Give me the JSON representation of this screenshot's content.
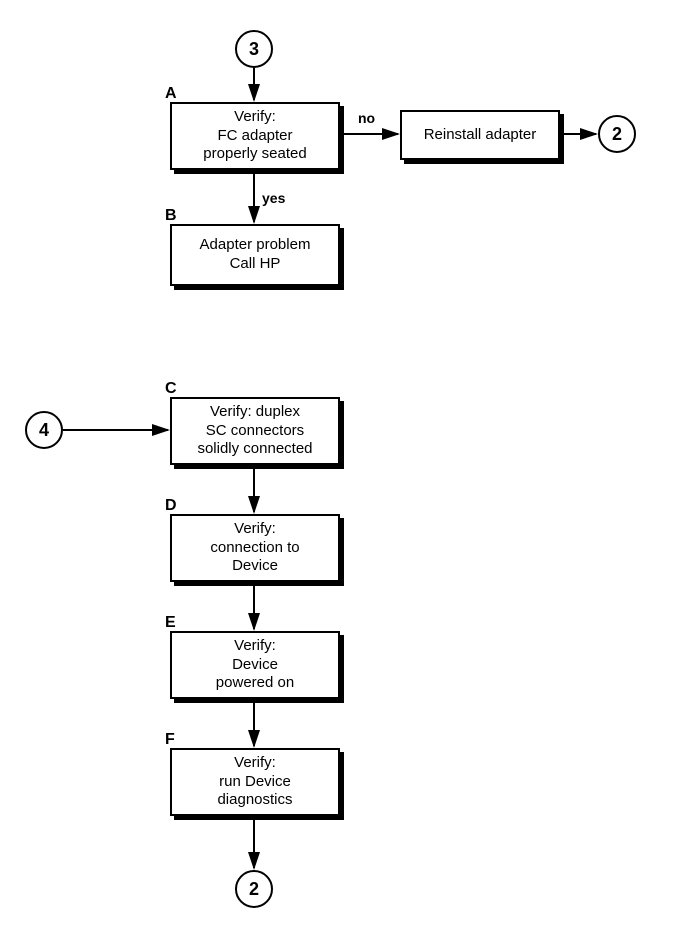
{
  "connectors": {
    "top": "3",
    "left": "4",
    "right": "2",
    "bottom": "2"
  },
  "boxes": {
    "A": {
      "label": "A",
      "text": "Verify:\nFC adapter\nproperly seated"
    },
    "R": {
      "text": "Reinstall adapter"
    },
    "B": {
      "label": "B",
      "text": "Adapter problem\nCall HP"
    },
    "C": {
      "label": "C",
      "text": "Verify: duplex\nSC connectors\nsolidly connected"
    },
    "D": {
      "label": "D",
      "text": "Verify:\nconnection to\nDevice"
    },
    "E": {
      "label": "E",
      "text": "Verify:\nDevice\npowered on"
    },
    "F": {
      "label": "F",
      "text": "Verify:\nrun Device\ndiagnostics"
    }
  },
  "edges": {
    "no": "no",
    "yes": "yes"
  }
}
